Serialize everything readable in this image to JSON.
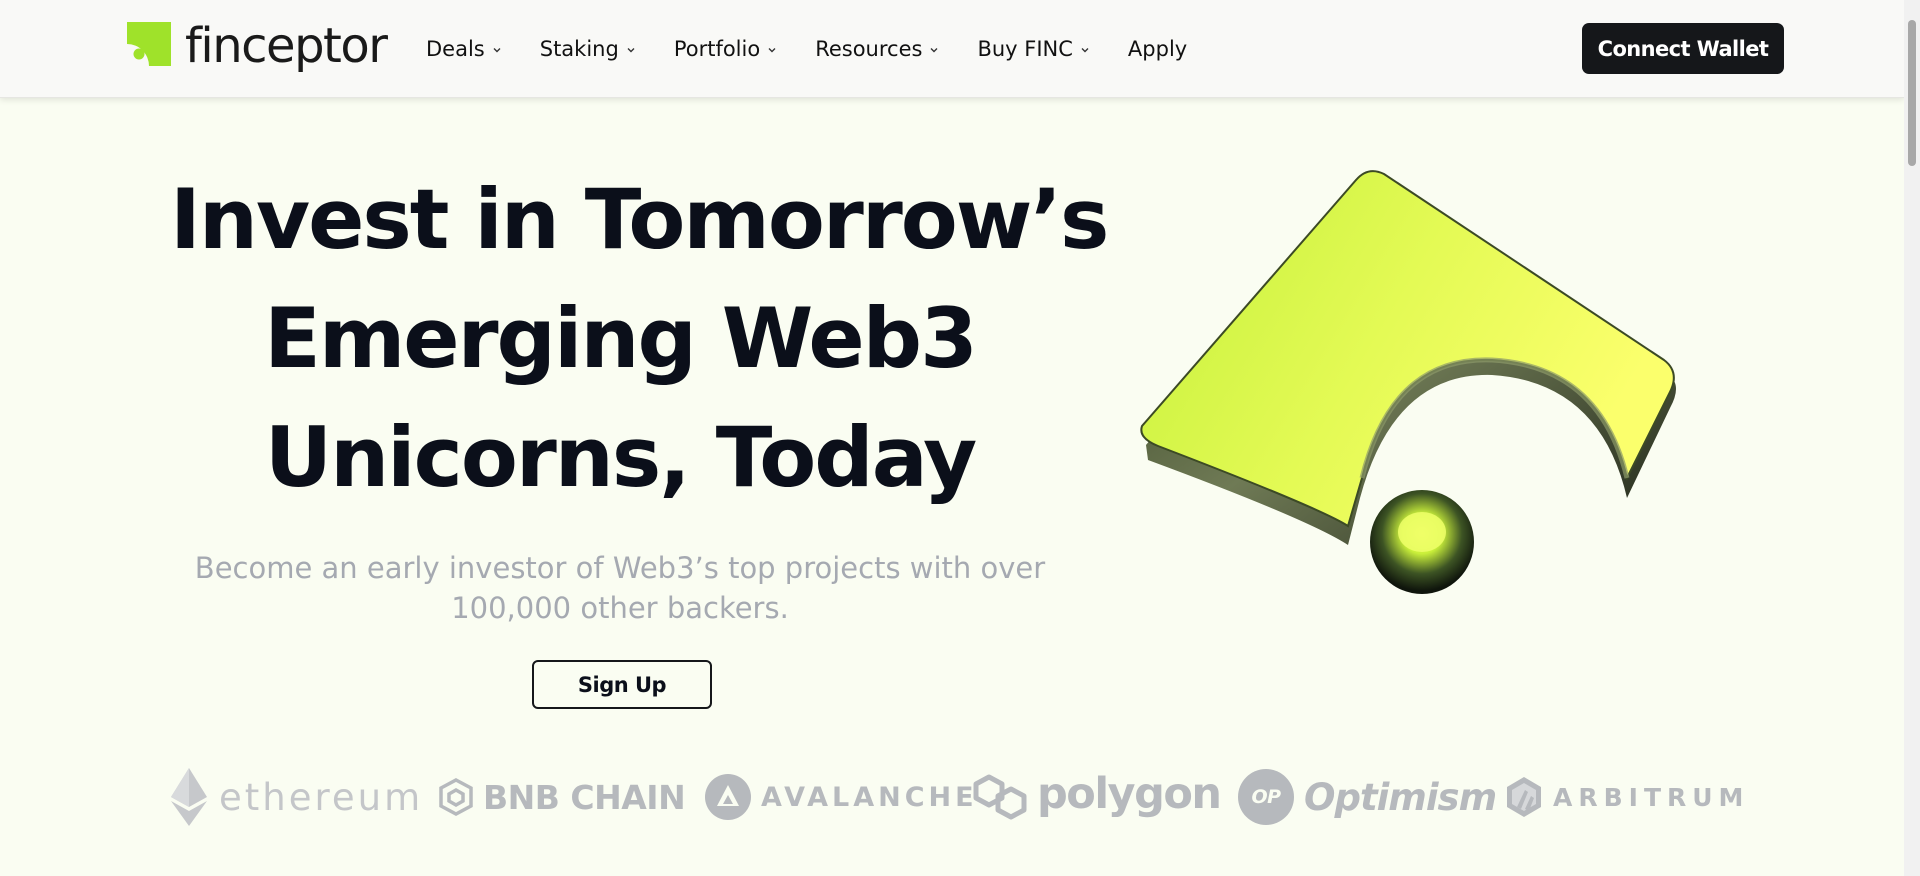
{
  "brand": {
    "name": "finceptor",
    "accent": "#9fe22a"
  },
  "nav": {
    "items": [
      {
        "label": "Deals",
        "has_dropdown": true
      },
      {
        "label": "Staking",
        "has_dropdown": true
      },
      {
        "label": "Portfolio",
        "has_dropdown": true
      },
      {
        "label": "Resources",
        "has_dropdown": true
      },
      {
        "label": "Buy FINC",
        "has_dropdown": true
      },
      {
        "label": "Apply",
        "has_dropdown": false
      }
    ],
    "connect_label": "Connect Wallet"
  },
  "hero": {
    "title_lines": [
      "Invest in Tomorrow’s",
      "Emerging Web3",
      "Unicorns, Today"
    ],
    "subtitle": "Become an early investor of Web3’s top projects with over 100,000 other backers.",
    "cta_label": "Sign Up"
  },
  "chains": {
    "ethereum": "ethereum",
    "bnb": "BNB CHAIN",
    "avalanche": "AVALANCHE",
    "polygon": "polygon",
    "optimism": "Optimism",
    "optimism_badge": "OP",
    "arbitrum": "ARBITRUM"
  },
  "icons": [
    "finceptor-logo-icon",
    "chevron-down-icon",
    "ethereum-icon",
    "bnb-chain-icon",
    "avalanche-icon",
    "polygon-icon",
    "optimism-icon",
    "arbitrum-icon"
  ],
  "colors": {
    "background": "#fafdf2",
    "text": "#0b0f1a",
    "button_dark": "#15171a",
    "muted": "#a5a9b1"
  }
}
